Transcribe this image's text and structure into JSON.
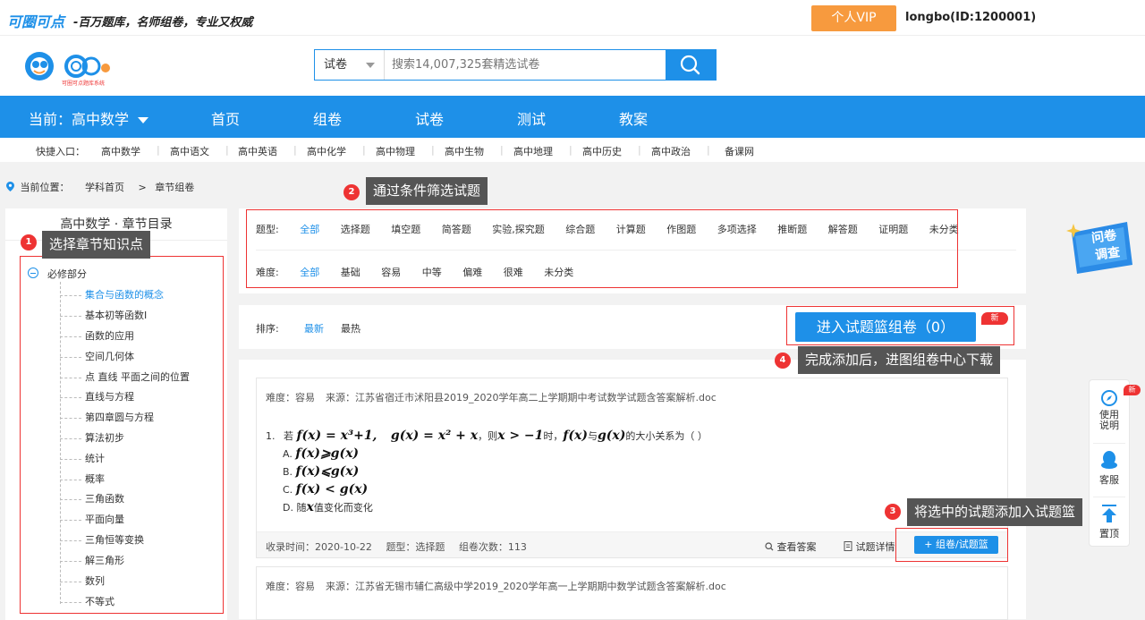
{
  "topbar": {
    "brand": "可圈可点",
    "slogan": "-百万题库，名师组卷，专业又权威",
    "vip_label": "个人VIP",
    "user": "longbo(ID:1200001)"
  },
  "logo": {
    "caption": "可圈可点题库系统"
  },
  "search": {
    "type": "试卷",
    "placeholder": "搜索14,007,325套精选试卷"
  },
  "nav": {
    "current": "当前：高中数学",
    "items": [
      "首页",
      "组卷",
      "试卷",
      "测试",
      "教案"
    ]
  },
  "quick": {
    "label": "快捷入口：",
    "items": [
      "高中数学",
      "高中语文",
      "高中英语",
      "高中化学",
      "高中物理",
      "高中生物",
      "高中地理",
      "高中历史",
      "高中政治",
      "备课网"
    ]
  },
  "breadcrumb": {
    "label": "当前位置：",
    "items": [
      "学科首页",
      ">",
      "章节组卷"
    ]
  },
  "chapters": {
    "title": "高中数学 · 章节目录",
    "root": "必修部分",
    "items": [
      "集合与函数的概念",
      "基本初等函数I",
      "函数的应用",
      "空间几何体",
      "点 直线 平面之间的位置",
      "直线与方程",
      "第四章圆与方程",
      "算法初步",
      "统计",
      "概率",
      "三角函数",
      "平面向量",
      "三角恒等变换",
      "解三角形",
      "数列",
      "不等式"
    ]
  },
  "filter": {
    "type_label": "题型:",
    "types": [
      "全部",
      "选择题",
      "填空题",
      "简答题",
      "实验,探究题",
      "综合题",
      "计算题",
      "作图题",
      "多项选择",
      "推断题",
      "解答题",
      "证明题",
      "未分类"
    ],
    "diff_label": "难度:",
    "difficulties": [
      "全部",
      "基础",
      "容易",
      "中等",
      "偏难",
      "很难",
      "未分类"
    ]
  },
  "sort": {
    "label": "排序:",
    "newest": "最新",
    "hottest": "最热"
  },
  "basket": {
    "label": "进入试题篮组卷（0）",
    "new_badge": "新"
  },
  "questions": [
    {
      "difficulty": "难度：容易",
      "source": "来源：江苏省宿迁市沭阳县2019_2020学年高二上学期期中考试数学试题含答案解析.doc",
      "number": "1.",
      "stem_pre": "若",
      "f_def": "f(x) = x³+1,",
      "g_def": "g(x) = x² + x",
      "cond_pre": "，则",
      "cond": "x > −1",
      "cond_post": "时，",
      "f": "f(x)",
      "mid": "与",
      "g": "g(x)",
      "stem_post": "的大小关系为（    ）",
      "options": [
        {
          "key": "A.",
          "math": "f(x)⩾g(x)",
          "text": ""
        },
        {
          "key": "B.",
          "math": "f(x)⩽g(x)",
          "text": ""
        },
        {
          "key": "C.",
          "math": "f(x) < g(x)",
          "text": ""
        },
        {
          "key": "D.",
          "pre": "随",
          "math": "x",
          "text": "值变化而变化"
        }
      ],
      "date": "收录时间：2020-10-22",
      "qtype": "题型：选择题",
      "count": "组卷次数：113",
      "view_answer": "查看答案",
      "detail": "试题详情",
      "add": "+ 组卷/试题篮"
    },
    {
      "difficulty": "难度：容易",
      "source": "来源：江苏省无锡市辅仁高级中学2019_2020学年高一上学期期中数学试题含答案解析.doc"
    }
  ],
  "tips": [
    {
      "num": "1",
      "text": "选择章节知识点"
    },
    {
      "num": "2",
      "text": "通过条件筛选试题"
    },
    {
      "num": "3",
      "text": "将选中的试题添加入试题篮"
    },
    {
      "num": "4",
      "text": "完成添加后，进图组卷中心下载"
    }
  ],
  "sidebar": {
    "guide": "使用说明",
    "guide_badge": "新",
    "service": "客服",
    "top": "置顶"
  },
  "survey": {
    "line1": "问卷",
    "line2": "调查"
  },
  "colors": {
    "primary": "#1e90e8",
    "accent": "#f79a3e",
    "alert": "#e33333"
  }
}
